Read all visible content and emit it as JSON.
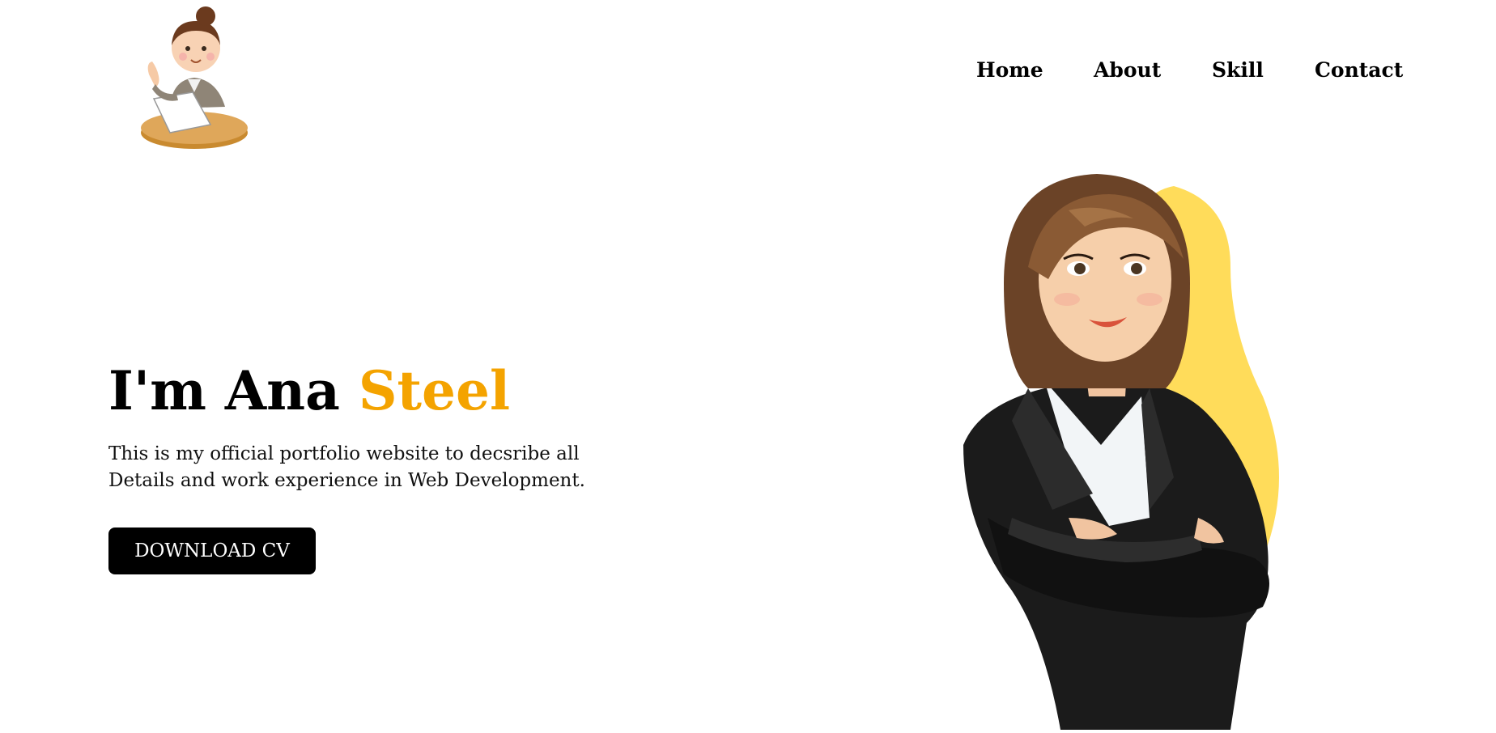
{
  "nav": {
    "home": "Home",
    "about": "About",
    "skill": "Skill",
    "contact": "Contact"
  },
  "hero": {
    "title_prefix": "I'm Ana ",
    "title_accent": "Steel",
    "description": "This is my official portfolio website to decsribe all Details and work experience in Web Development.",
    "download_label": "DOWNLOAD CV"
  },
  "colors": {
    "accent": "#f4a300",
    "blob": "#ffdc5a",
    "button_bg": "#000000",
    "button_text": "#ffffff"
  },
  "icons": {
    "logo": "woman-at-desk-logo",
    "illustration": "businesswoman-illustration"
  }
}
